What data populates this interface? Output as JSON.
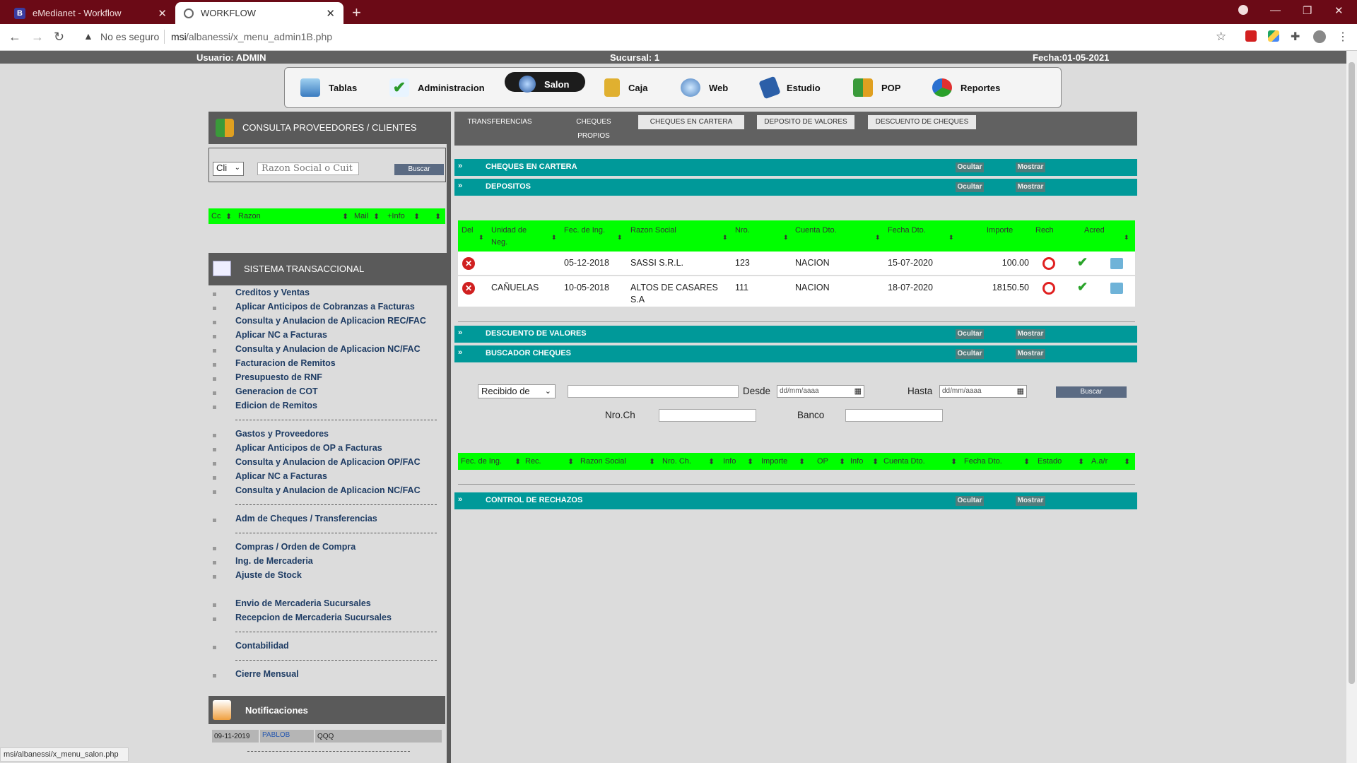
{
  "browser": {
    "tabs": [
      {
        "title": "eMedianet - Workflow",
        "favicon": "B"
      },
      {
        "title": "WORKFLOW"
      }
    ],
    "security": "No es seguro",
    "url_host": "msi",
    "url_path": "/albanessi/x_menu_admin1B.php",
    "status_url": "msi/albanessi/x_menu_salon.php",
    "colors": {
      "tabbar": "#6b0a16",
      "accent_green": "#00ff00",
      "section_teal": "#009999"
    }
  },
  "info": {
    "user": "Usuario: ADMIN",
    "branch": "Sucursal: 1",
    "date": "Fecha:01-05-2021"
  },
  "topmenu": [
    {
      "label": "Tablas",
      "icon": "tables-icon"
    },
    {
      "label": "Administracion",
      "icon": "check-document-icon"
    },
    {
      "label": "Salon",
      "icon": "globe-icon",
      "active": true
    },
    {
      "label": "Caja",
      "icon": "cash-box-icon"
    },
    {
      "label": "Web",
      "icon": "web-magnifier-icon"
    },
    {
      "label": "Estudio",
      "icon": "book-icon"
    },
    {
      "label": "POP",
      "icon": "chart-people-icon"
    },
    {
      "label": "Reportes",
      "icon": "pie-chart-icon"
    }
  ],
  "left": {
    "consulta_title": "CONSULTA PROVEEDORES / CLIENTES",
    "type_select": "Cli",
    "search_placeholder": "Razon Social o Cuit",
    "search_button": "Buscar",
    "list_headers": {
      "cc": "Cc",
      "razon": "Razon",
      "mail": "Mail",
      "info": "+Info"
    },
    "sistema_title": "SISTEMA TRANSACCIONAL",
    "menu": [
      "Creditos y Ventas",
      "Aplicar Anticipos de Cobranzas a Facturas",
      "Consulta y Anulacion de Aplicacion REC/FAC",
      "Aplicar NC a Facturas",
      "Consulta y Anulacion de Aplicacion NC/FAC",
      "Facturacion de Remitos",
      "Presupuesto de RNF",
      "Generacion de COT",
      "Edicion de Remitos",
      "Gastos y Proveedores",
      "Aplicar Anticipos de OP a Facturas",
      "Consulta y Anulacion de Aplicacion OP/FAC",
      "Aplicar NC a Facturas",
      "Consulta y Anulacion de Aplicacion NC/FAC",
      "Adm de Cheques / Transferencias",
      "Compras / Orden de Compra",
      "Ing. de Mercaderia",
      "Ajuste de Stock",
      "Envio de Mercaderia Sucursales",
      "Recepcion de Mercaderia Sucursales",
      "Contabilidad",
      "Cierre Mensual"
    ],
    "notificaciones_title": "Notificaciones",
    "notif": {
      "date": "09-11-2019",
      "user": "PABLOB",
      "msg": "QQQ"
    }
  },
  "right": {
    "tabs": [
      "TRANSFERENCIAS",
      "CHEQUES PROPIOS",
      "CHEQUES EN CARTERA",
      "DEPOSITO DE VALORES",
      "DESCUENTO DE CHEQUES"
    ],
    "hide": "Ocultar",
    "show": "Mostrar",
    "sections": [
      "CHEQUES EN CARTERA",
      "DEPOSITOS",
      "DESCUENTO DE VALORES",
      "BUSCADOR CHEQUES",
      "CONTROL DE RECHAZOS"
    ],
    "dep_headers": [
      "Del",
      "Unidad de Neg.",
      "Fec. de Ing.",
      "Razon Social",
      "Nro.",
      "Cuenta Dto.",
      "Fecha Dto.",
      "Importe",
      "Rech",
      "Acred"
    ],
    "dep_rows": [
      {
        "unidad": "",
        "fec_ing": "05-12-2018",
        "razon": "SASSI S.R.L.",
        "nro": "123",
        "cuenta": "NACION",
        "fecha_dto": "15-07-2020",
        "importe": "100.00"
      },
      {
        "unidad": "CAÑUELAS",
        "fec_ing": "10-05-2018",
        "razon": "ALTOS DE CASARES S.A",
        "nro": "111",
        "cuenta": "NACION",
        "fecha_dto": "18-07-2020",
        "importe": "18150.50"
      }
    ],
    "buscador": {
      "select": "Recibido de",
      "desde": "Desde",
      "hasta": "Hasta",
      "date_placeholder": "dd/mm/aaaa",
      "buscar": "Buscar",
      "nro_ch": "Nro.Ch",
      "banco": "Banco"
    },
    "cheq_headers": [
      "Fec. de Ing.",
      "Rec.",
      "Razon Social",
      "Nro. Ch.",
      "Info",
      "Importe",
      "OP",
      "Info",
      "Cuenta Dto.",
      "Fecha Dto.",
      "Estado",
      "A.a/r"
    ]
  }
}
